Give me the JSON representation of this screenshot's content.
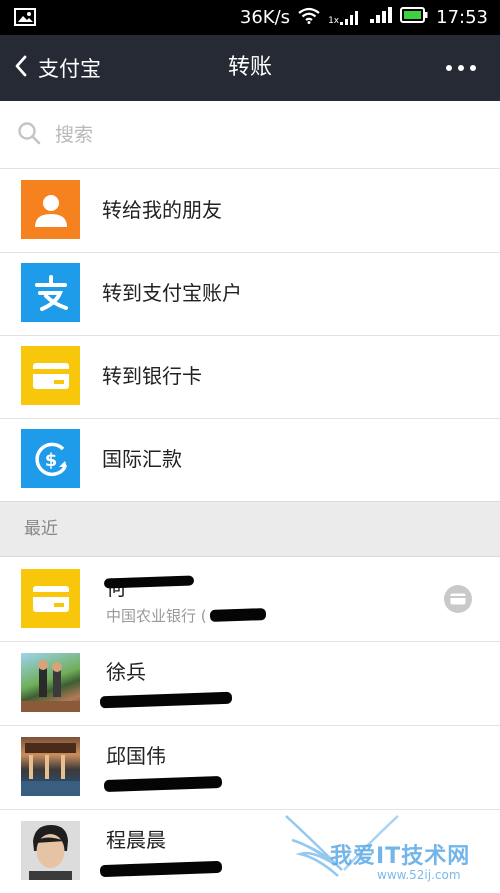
{
  "status_bar": {
    "speed": "36K/s",
    "time": "17:53",
    "sim_label": "1x",
    "icons": [
      "image-icon",
      "wifi-icon",
      "signal-icon",
      "battery-icon"
    ]
  },
  "nav": {
    "back_label": "支付宝",
    "title": "转账",
    "back_icon": "chevron-left-icon",
    "more_icon": "more-dots-icon"
  },
  "search": {
    "placeholder": "搜索",
    "icon": "search-icon"
  },
  "menu": {
    "items": [
      {
        "label": "转给我的朋友",
        "icon": "person-icon",
        "color": "#f5811f"
      },
      {
        "label": "转到支付宝账户",
        "icon": "alipay-logo-icon",
        "color": "#1e9be9"
      },
      {
        "label": "转到银行卡",
        "icon": "bank-card-icon",
        "color": "#f8c70c"
      },
      {
        "label": "国际汇款",
        "icon": "dollar-globe-icon",
        "color": "#1e9be9"
      }
    ]
  },
  "recent": {
    "header": "最近",
    "items": [
      {
        "name": "何",
        "sub": "中国农业银行 (",
        "avatar": "bank-card-icon",
        "color": "#f8c70c"
      },
      {
        "name": "徐兵",
        "sub": "",
        "avatar": "photo-avatar"
      },
      {
        "name": "邱国伟",
        "sub": "",
        "avatar": "photo-avatar"
      },
      {
        "name": "程晨晨",
        "sub": "",
        "avatar": "photo-avatar"
      }
    ]
  },
  "watermark": {
    "text": "我爱IT技术网",
    "url": "www.52ij.com"
  }
}
